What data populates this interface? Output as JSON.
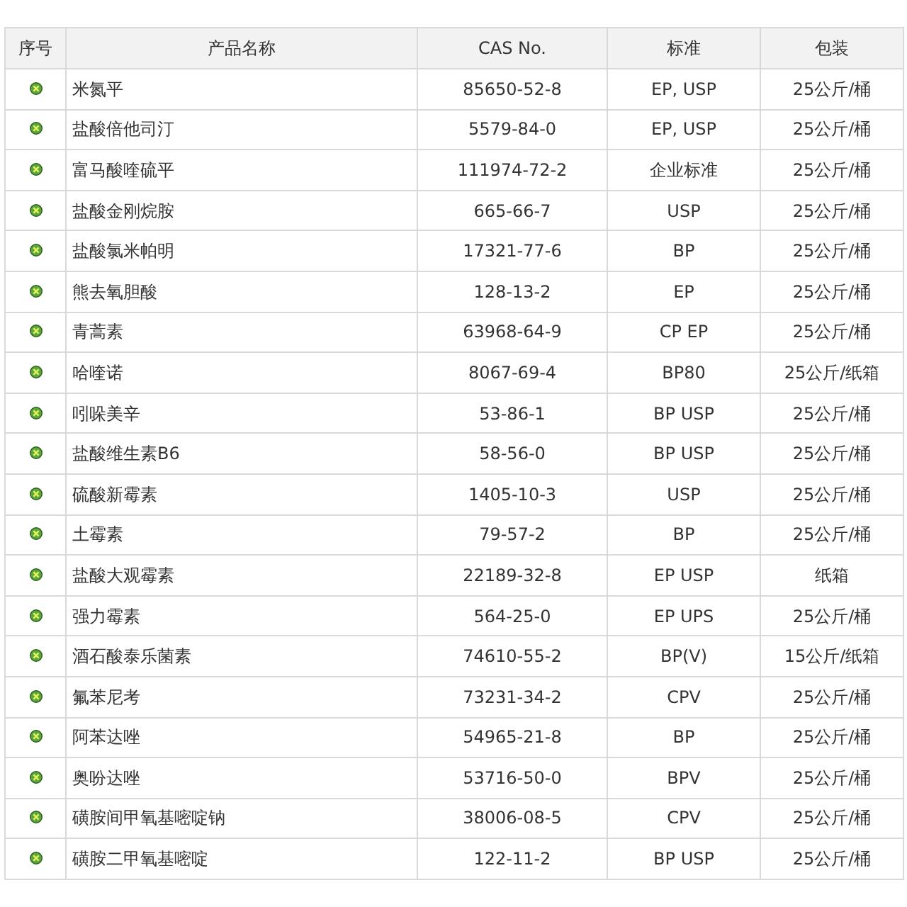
{
  "table": {
    "columns": [
      "序号",
      "产品名称",
      "CAS No.",
      "标准",
      "包装"
    ],
    "rows": [
      {
        "name": "米氮平",
        "cas": "85650-52-8",
        "standard": "EP, USP",
        "package": "25公斤/桶"
      },
      {
        "name": "盐酸倍他司汀",
        "cas": "5579-84-0",
        "standard": "EP, USP",
        "package": "25公斤/桶"
      },
      {
        "name": "富马酸喹硫平",
        "cas": "111974-72-2",
        "standard": "企业标准",
        "package": "25公斤/桶"
      },
      {
        "name": "盐酸金刚烷胺",
        "cas": "665-66-7",
        "standard": "USP",
        "package": "25公斤/桶"
      },
      {
        "name": "盐酸氯米帕明",
        "cas": "17321-77-6",
        "standard": "BP",
        "package": "25公斤/桶"
      },
      {
        "name": "熊去氧胆酸",
        "cas": "128-13-2",
        "standard": "EP",
        "package": "25公斤/桶"
      },
      {
        "name": "青蒿素",
        "cas": "63968-64-9",
        "standard": "CP EP",
        "package": "25公斤/桶"
      },
      {
        "name": "哈喹诺",
        "cas": "8067-69-4",
        "standard": "BP80",
        "package": "25公斤/纸箱"
      },
      {
        "name": "吲哚美辛",
        "cas": "53-86-1",
        "standard": "BP USP",
        "package": "25公斤/桶"
      },
      {
        "name": "盐酸维生素B6",
        "cas": "58-56-0",
        "standard": "BP USP",
        "package": "25公斤/桶"
      },
      {
        "name": "硫酸新霉素",
        "cas": "1405-10-3",
        "standard": "USP",
        "package": "25公斤/桶"
      },
      {
        "name": "土霉素",
        "cas": "79-57-2",
        "standard": "BP",
        "package": "25公斤/桶"
      },
      {
        "name": "盐酸大观霉素",
        "cas": "22189-32-8",
        "standard": "EP USP",
        "package": "纸箱"
      },
      {
        "name": "强力霉素",
        "cas": "564-25-0",
        "standard": "EP UPS",
        "package": "25公斤/桶"
      },
      {
        "name": "酒石酸泰乐菌素",
        "cas": "74610-55-2",
        "standard": "BP(V)",
        "package": "15公斤/纸箱"
      },
      {
        "name": "氟苯尼考",
        "cas": "73231-34-2",
        "standard": "CPV",
        "package": "25公斤/桶"
      },
      {
        "name": "阿苯达唑",
        "cas": "54965-21-8",
        "standard": "BP",
        "package": "25公斤/桶"
      },
      {
        "name": "奥吩达唑",
        "cas": "53716-50-0",
        "standard": "BPV",
        "package": "25公斤/桶"
      },
      {
        "name": "磺胺间甲氧基嘧啶钠",
        "cas": "38006-08-5",
        "standard": "CPV",
        "package": "25公斤/桶"
      },
      {
        "name": "磺胺二甲氧基嘧啶",
        "cas": "122-11-2",
        "standard": "BP USP",
        "package": "25公斤/桶"
      }
    ]
  }
}
